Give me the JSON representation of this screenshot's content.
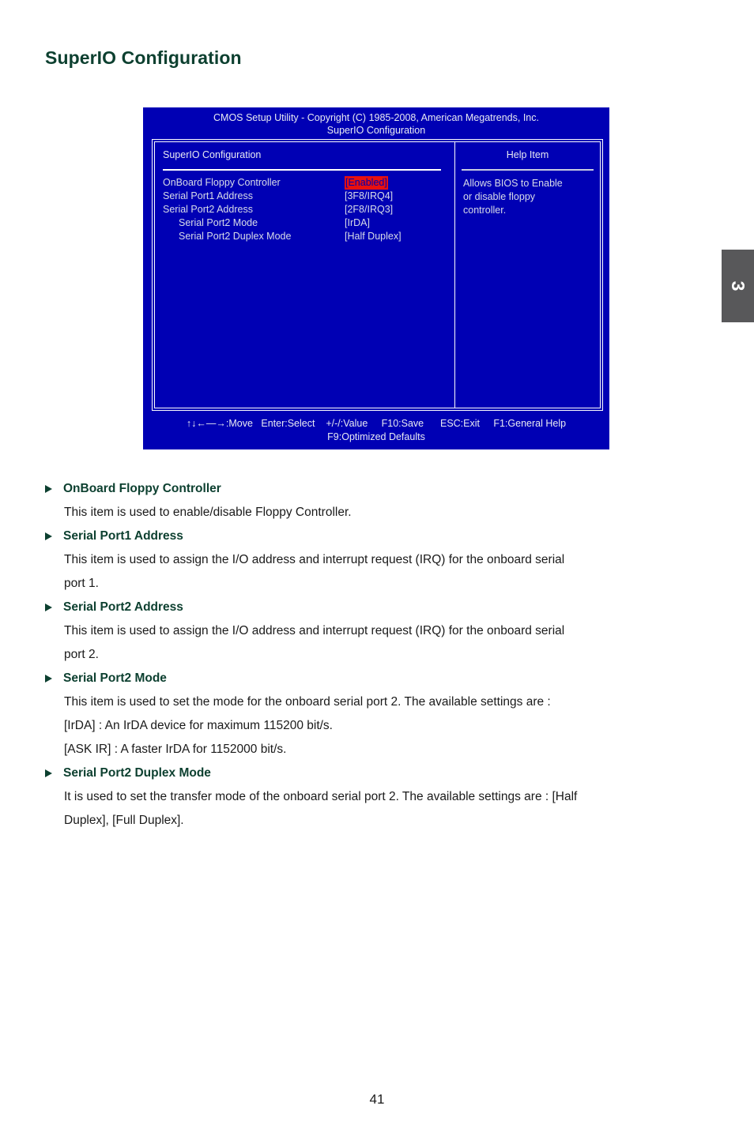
{
  "page": {
    "title": "SuperIO Configuration",
    "number": "41",
    "chapter_tab": "3"
  },
  "bios": {
    "title_line1": "CMOS Setup Utility - Copyright (C) 1985-2008, American Megatrends, Inc.",
    "title_line2": "SuperIO Configuration",
    "section_header": "SuperIO Configuration",
    "help_header": "Help Item",
    "menu_items": [
      {
        "label": "OnBoard Floppy Controller",
        "value": "[Enabled]",
        "selected": true,
        "indent": false
      },
      {
        "label": "Serial Port1 Address",
        "value": "[3F8/IRQ4]",
        "selected": false,
        "indent": false
      },
      {
        "label": "Serial Port2 Address",
        "value": "[2F8/IRQ3]",
        "selected": false,
        "indent": false
      },
      {
        "label": "Serial Port2 Mode",
        "value": "[IrDA]",
        "selected": false,
        "indent": true
      },
      {
        "label": "Serial Port2 Duplex Mode",
        "value": "[Half Duplex]",
        "selected": false,
        "indent": true
      }
    ],
    "help_lines": [
      "Allows BIOS to Enable",
      "or disable floppy",
      "controller."
    ],
    "footer_keys": "↑↓←—→:Move   Enter:Select    +/-/:Value     F10:Save      ESC:Exit     F1:General Help",
    "footer_defaults": "F9:Optimized Defaults",
    "colors": {
      "background": "#0000b4",
      "text": "#d8dce8",
      "selected_background": "#e81010",
      "selected_text": "#0000b4",
      "border": "#ffffff"
    }
  },
  "descriptions": [
    {
      "heading": "OnBoard Floppy Controller",
      "lines": [
        "This item is used to enable/disable Floppy Controller."
      ]
    },
    {
      "heading": "Serial Port1 Address",
      "lines": [
        "This item is used to assign the I/O address and interrupt request (IRQ) for the onboard serial",
        "port 1."
      ]
    },
    {
      "heading": "Serial Port2 Address",
      "lines": [
        "This item is used to assign the I/O address and interrupt request (IRQ) for the onboard serial",
        "port 2."
      ]
    },
    {
      "heading": "Serial Port2 Mode",
      "lines": [
        "This item is used to set the mode for the onboard serial port 2. The available settings are :",
        "[IrDA] : An IrDA device for maximum 115200 bit/s.",
        "[ASK IR] : A faster IrDA for 1152000 bit/s."
      ]
    },
    {
      "heading": "Serial Port2 Duplex Mode",
      "lines": [
        "It is used to set the transfer mode of the onboard serial port 2. The available settings are : [Half",
        "Duplex], [Full Duplex]."
      ]
    }
  ],
  "theme": {
    "heading_color": "#0d4030",
    "tab_color": "#58585a"
  }
}
